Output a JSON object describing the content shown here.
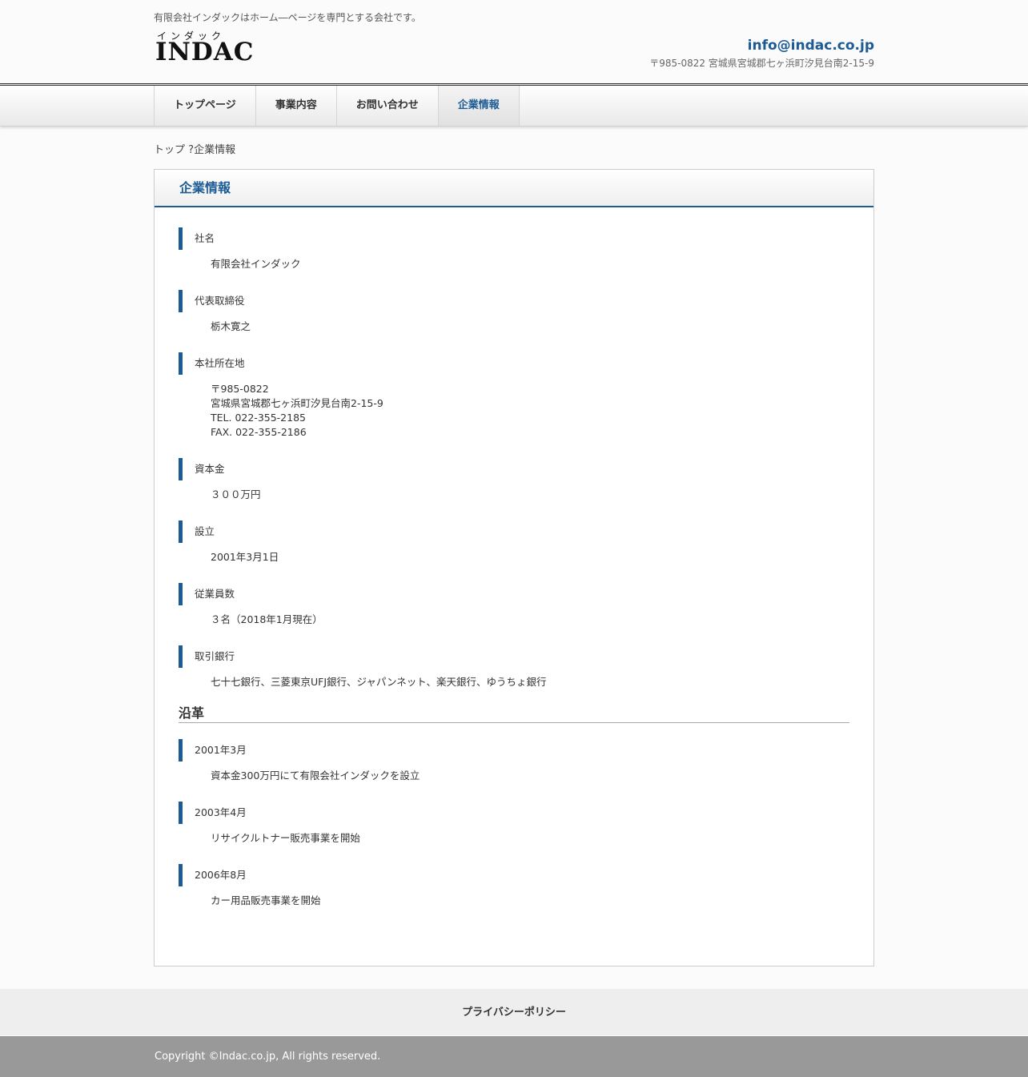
{
  "header": {
    "tagline": "有限会社インダックはホーム―ページを専門とする会社です。",
    "logo_ruby": "インダック",
    "logo_text": "INDAC",
    "email": "info@indac.co.jp",
    "address": "〒985-0822 宮城県宮城郡七ヶ浜町汐見台南2-15-9"
  },
  "nav": {
    "items": [
      {
        "label": "トップページ"
      },
      {
        "label": "事業内容"
      },
      {
        "label": "お問い合わせ"
      },
      {
        "label": "企業情報",
        "current": true
      }
    ]
  },
  "breadcrumb": {
    "home": "トップ",
    "separator": "?",
    "current": "企業情報"
  },
  "main": {
    "title": "企業情報",
    "company_items": [
      {
        "label": "社名",
        "lines": [
          "有限会社インダック"
        ]
      },
      {
        "label": "代表取締役",
        "lines": [
          "栃木寛之"
        ]
      },
      {
        "label": "本社所在地",
        "lines": [
          "〒985-0822",
          "宮城県宮城郡七ヶ浜町汐見台南2-15-9",
          "TEL. 022-355-2185",
          "FAX. 022-355-2186"
        ]
      },
      {
        "label": "資本金",
        "lines": [
          "３００万円"
        ]
      },
      {
        "label": "設立",
        "lines": [
          "2001年3月1日"
        ]
      },
      {
        "label": "従業員数",
        "lines": [
          "３名（2018年1月現在）"
        ]
      },
      {
        "label": "取引銀行",
        "lines": [
          "七十七銀行、三菱東京UFJ銀行、ジャパンネット、楽天銀行、ゆうちょ銀行"
        ]
      }
    ],
    "history_heading": "沿革",
    "history_items": [
      {
        "label": "2001年3月",
        "lines": [
          "資本金300万円にて有限会社インダックを設立"
        ]
      },
      {
        "label": "2003年4月",
        "lines": [
          "リサイクルトナー販売事業を開始"
        ]
      },
      {
        "label": "2006年8月",
        "lines": [
          "カー用品販売事業を開始"
        ]
      }
    ]
  },
  "footer": {
    "privacy_link": "プライバシーポリシー",
    "copyright": "Copyright ©Indac.co.jp, All rights reserved."
  },
  "colors": {
    "accent": "#1c5b94",
    "footer_bg": "#eeeeee",
    "copyright_bg": "#999999"
  }
}
